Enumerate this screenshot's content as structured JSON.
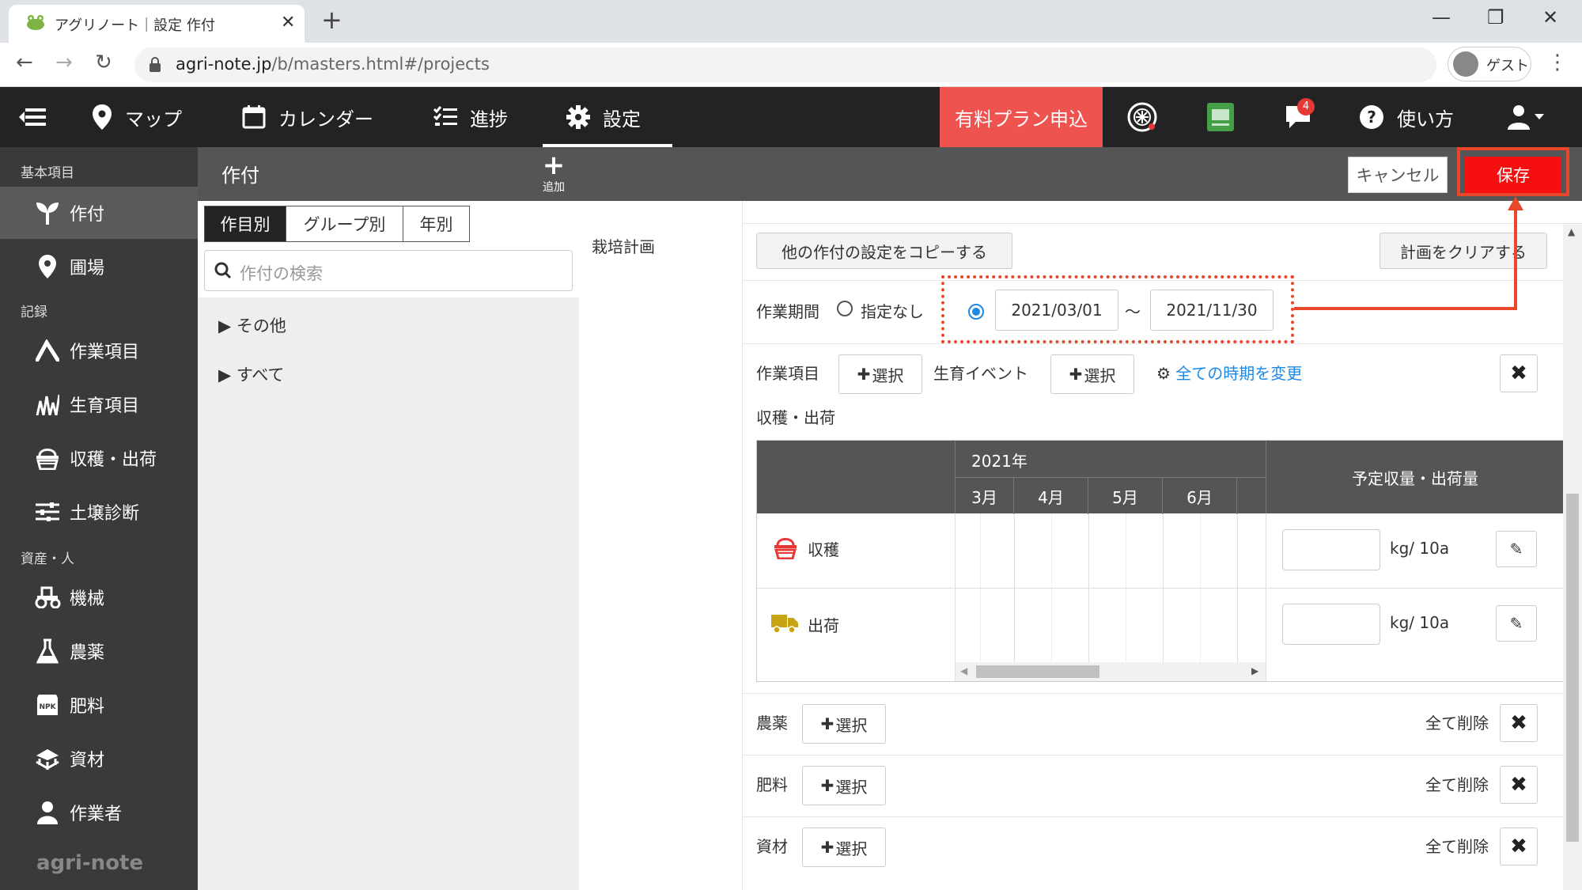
{
  "browser": {
    "tab_title": "アグリノート｜設定 作付",
    "url_host": "agri-note.jp",
    "url_path": "/b/masters.html#/projects",
    "guest_label": "ゲスト"
  },
  "header": {
    "nav": [
      {
        "label": "マップ",
        "icon": "map-pin-icon"
      },
      {
        "label": "カレンダー",
        "icon": "calendar-icon"
      },
      {
        "label": "進捗",
        "icon": "checklist-icon"
      },
      {
        "label": "設定",
        "icon": "gear-icon"
      }
    ],
    "premium_label": "有料プラン申込",
    "notification_count": "4",
    "help_label": "使い方"
  },
  "sidebar": {
    "sections": [
      "基本項目",
      "記録",
      "資産・人"
    ],
    "items": [
      {
        "label": "作付",
        "icon": "sprout-icon"
      },
      {
        "label": "圃場",
        "icon": "map-pin-icon"
      },
      {
        "label": "作業項目",
        "icon": "work-icon"
      },
      {
        "label": "生育項目",
        "icon": "growth-icon"
      },
      {
        "label": "収穫・出荷",
        "icon": "basket-icon"
      },
      {
        "label": "土壌診断",
        "icon": "sliders-icon"
      },
      {
        "label": "機械",
        "icon": "tractor-icon"
      },
      {
        "label": "農薬",
        "icon": "flask-icon"
      },
      {
        "label": "肥料",
        "icon": "npk-icon"
      },
      {
        "label": "資材",
        "icon": "materials-icon"
      },
      {
        "label": "作業者",
        "icon": "person-icon"
      }
    ],
    "logo": "agri-note"
  },
  "subheader": {
    "title": "作付",
    "add_label": "追加",
    "cancel_label": "キャンセル",
    "save_label": "保存"
  },
  "crop_list": {
    "segments": [
      "作目別",
      "グループ別",
      "年別"
    ],
    "search_placeholder": "作付の検索",
    "tree": [
      "その他",
      "すべて"
    ]
  },
  "form": {
    "section_label": "栽培計画",
    "copy_button": "他の作付の設定をコピーする",
    "clear_button": "計画をクリアする",
    "period_label": "作業期間",
    "period_none": "指定なし",
    "start_date": "2021/03/01",
    "end_date": "2021/11/30",
    "tilde": "～",
    "work_items_label": "作業項目",
    "select_label": "選択",
    "growth_event_label": "生育イベント",
    "change_all_link": "全ての時期を変更",
    "harvest_ship_label": "収穫・出荷",
    "table": {
      "year": "2021年",
      "months": [
        "3月",
        "4月",
        "5月",
        "6月"
      ],
      "qty_header": "予定収量・出荷量",
      "rows": [
        {
          "label": "収穫",
          "unit": "kg/ 10a"
        },
        {
          "label": "出荷",
          "unit": "kg/ 10a"
        }
      ]
    },
    "pesticide_label": "農薬",
    "fertilizer_label": "肥料",
    "materials_label": "資材",
    "delete_all": "全て削除"
  }
}
